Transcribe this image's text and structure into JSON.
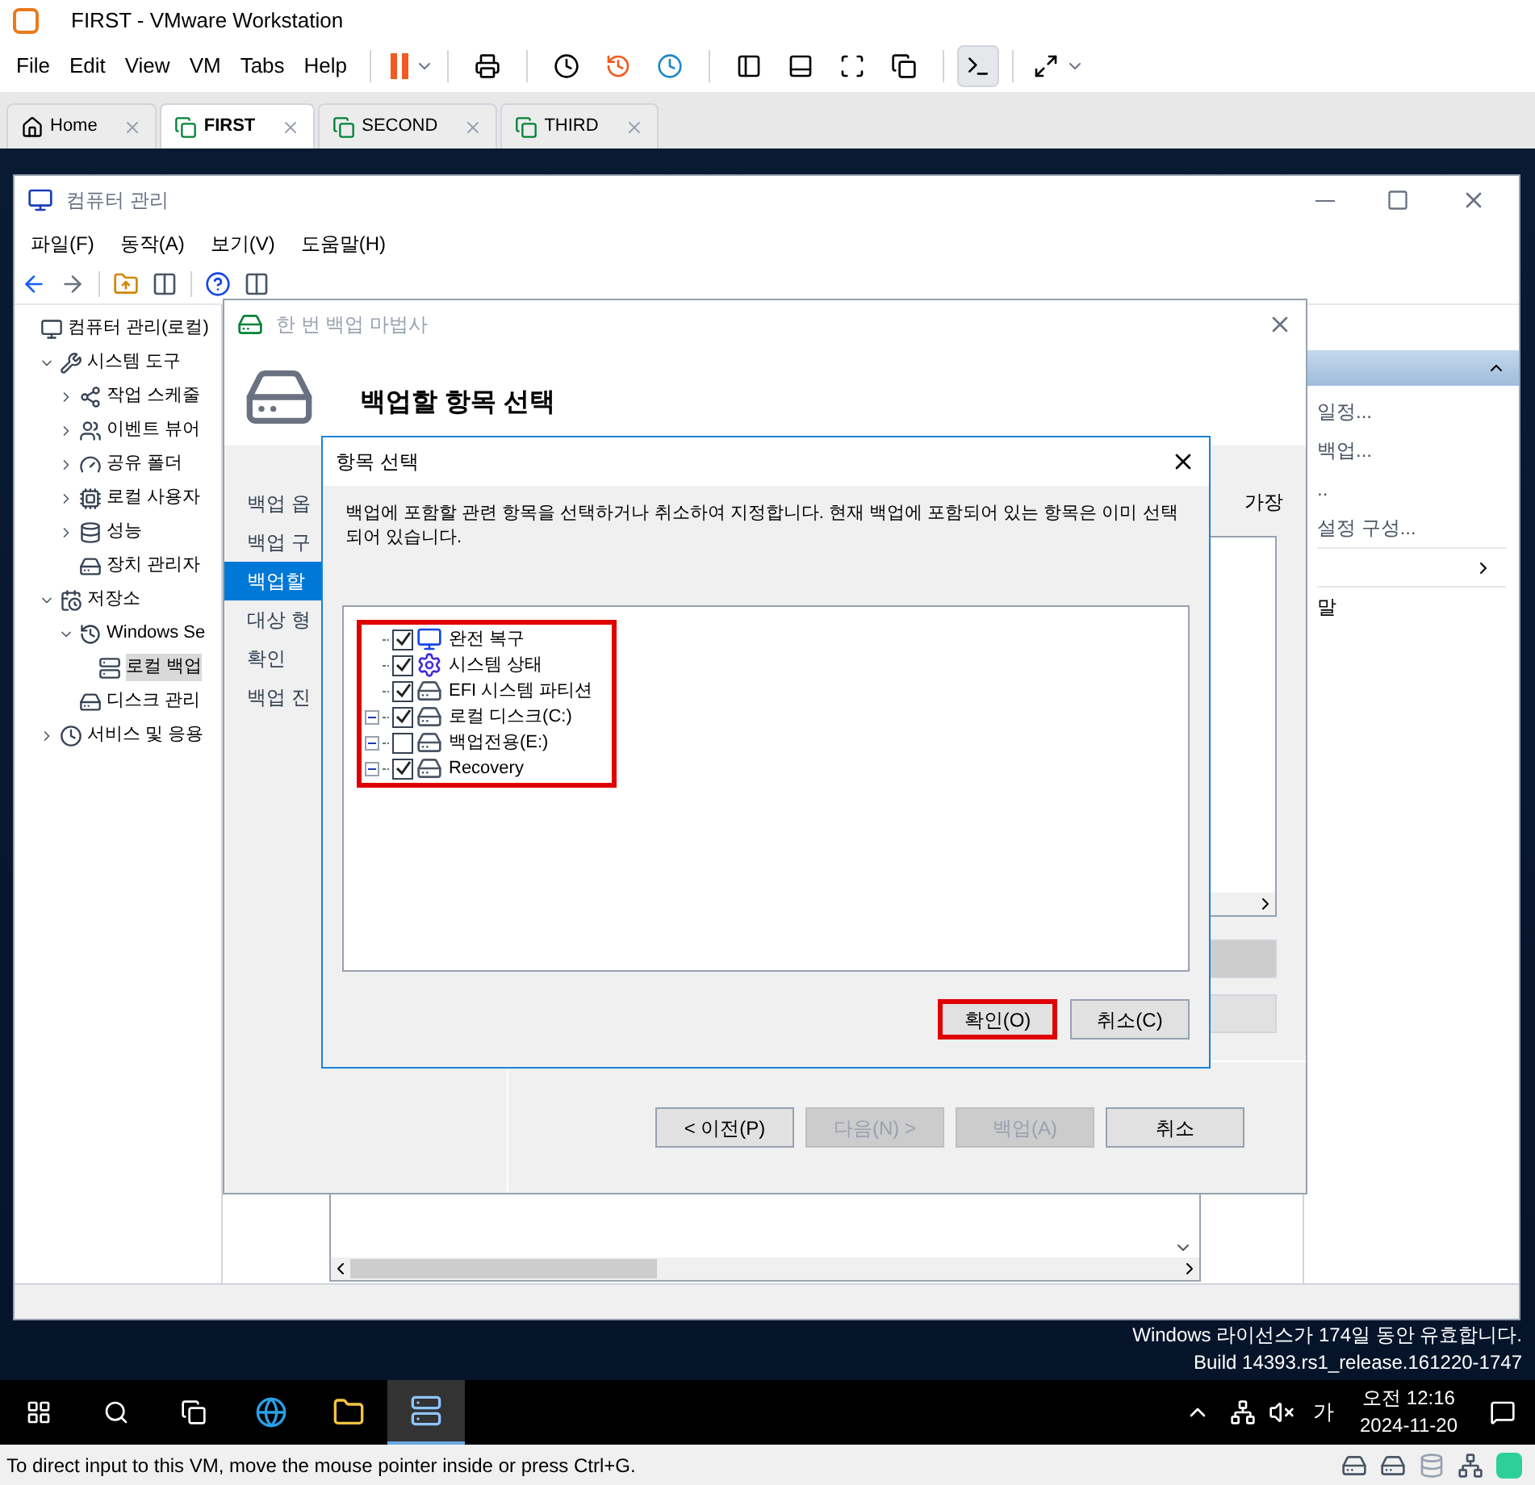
{
  "vmware": {
    "title": "FIRST - VMware Workstation",
    "menu": [
      "File",
      "Edit",
      "View",
      "VM",
      "Tabs",
      "Help"
    ],
    "tabs": [
      {
        "label": "Home",
        "selected": false
      },
      {
        "label": "FIRST",
        "selected": true
      },
      {
        "label": "SECOND",
        "selected": false
      },
      {
        "label": "THIRD",
        "selected": false
      }
    ],
    "status_text": "To direct input to this VM, move the mouse pointer inside or press Ctrl+G."
  },
  "computer_management": {
    "title": "컴퓨터 관리",
    "menu": [
      "파일(F)",
      "동작(A)",
      "보기(V)",
      "도움말(H)"
    ],
    "tree": [
      {
        "label": "컴퓨터 관리(로컬)",
        "selected": false,
        "children": [
          {
            "label": "시스템 도구",
            "selected": false,
            "expanded": true,
            "children": [
              {
                "label": "작업 스케줄",
                "selected": false,
                "expanded": false
              },
              {
                "label": "이벤트 뷰어",
                "selected": false,
                "expanded": false
              },
              {
                "label": "공유 폴더",
                "selected": false,
                "expanded": false
              },
              {
                "label": "로컬 사용자",
                "selected": false,
                "expanded": false
              },
              {
                "label": "성능",
                "selected": false,
                "expanded": false
              },
              {
                "label": "장치 관리자",
                "selected": false
              }
            ]
          },
          {
            "label": "저장소",
            "selected": false,
            "expanded": true,
            "children": [
              {
                "label": "Windows Se",
                "selected": false,
                "expanded": true,
                "children": [
                  {
                    "label": "로컬 백업",
                    "selected": true
                  }
                ]
              },
              {
                "label": "디스크 관리",
                "selected": false
              }
            ]
          },
          {
            "label": "서비스 및 응용",
            "selected": false,
            "expanded": false
          }
        ]
      }
    ],
    "actions": [
      "일정...",
      "백업...",
      "..",
      "설정 구성..."
    ],
    "actions_last": "말"
  },
  "wizard": {
    "title": "한 번 백업 마법사",
    "heading": "백업할 항목 선택",
    "steps": [
      {
        "label": "백업 옵",
        "selected": false
      },
      {
        "label": "백업 구",
        "selected": false
      },
      {
        "label": "백업할",
        "selected": true
      },
      {
        "label": "대상 형",
        "selected": false
      },
      {
        "label": "확인",
        "selected": false
      },
      {
        "label": "백업 진",
        "selected": false
      }
    ],
    "side_text": "가장",
    "buttons": [
      {
        "label": "< 이전(P)",
        "disabled": false
      },
      {
        "label": "다음(N) >",
        "disabled": true
      },
      {
        "label": "백업(A)",
        "disabled": true
      },
      {
        "label": "취소",
        "disabled": false
      }
    ]
  },
  "dialog": {
    "title": "항목 선택",
    "description": "백업에 포함할 관련 항목을 선택하거나 취소하여 지정합니다. 현재 백업에 포함되어 있는 항목은 이미 선택 되어 있습니다.",
    "items_highlighted": true,
    "items": [
      {
        "label": "완전 복구",
        "kind": "bare-metal",
        "checked": true,
        "expandable": false
      },
      {
        "label": "시스템 상태",
        "kind": "system-state",
        "checked": true,
        "expandable": false
      },
      {
        "label": "EFI 시스템 파티션",
        "kind": "volume",
        "checked": true,
        "expandable": false
      },
      {
        "label": "로컬 디스크(C:)",
        "kind": "volume",
        "checked": true,
        "expandable": true
      },
      {
        "label": "백업전용(E:)",
        "kind": "volume",
        "checked": false,
        "expandable": true
      },
      {
        "label": "Recovery",
        "kind": "volume",
        "checked": true,
        "expandable": true
      }
    ],
    "buttons": [
      {
        "label": "확인(O)",
        "highlighted": true
      },
      {
        "label": "취소(C)",
        "highlighted": false
      }
    ]
  },
  "desktop": {
    "license_text": "Windows 라이선스가 174일 동안 유효합니다.",
    "build_text": "Build 14393.rs1_release.161220-1747"
  },
  "taskbar": {
    "ime": "가",
    "time": "오전 12:16",
    "date": "2024-11-20"
  }
}
